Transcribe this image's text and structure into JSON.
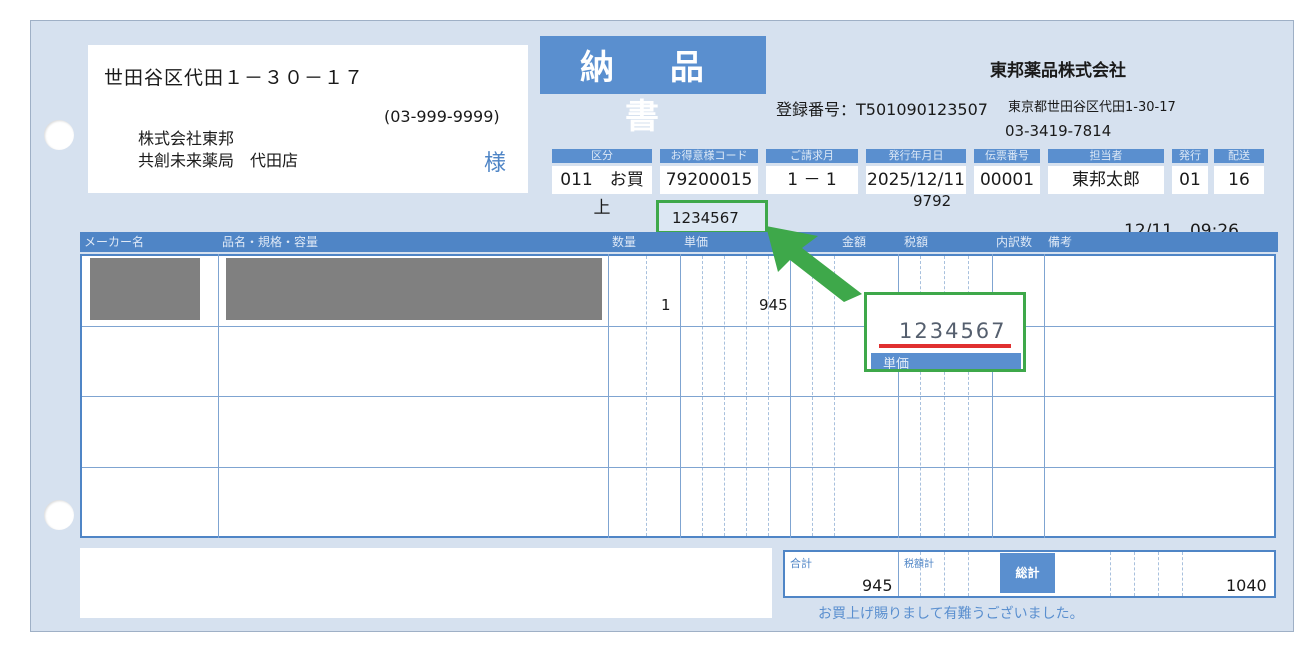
{
  "document": {
    "title": "納 品 書",
    "recipient": {
      "address": "世田谷区代田１－３０－１７",
      "phone": "(03-999-9999)",
      "company": "株式会社東邦",
      "store": "共創未来薬局　代田店",
      "honorific": "様"
    },
    "issuer": {
      "name": "東邦薬品株式会社",
      "registration": "登録番号：T501090123507",
      "address": "東京都世田谷区代田1-30-17",
      "phone": "03-3419-7814"
    },
    "header_labels": [
      "区分",
      "お得意様コード",
      "ご請求月",
      "発行年月日",
      "伝票番号",
      "担当者",
      "発行",
      "配送"
    ],
    "header_values": [
      "011　お買上",
      "79200015",
      "1 － 1",
      "2025/12/11",
      "00001",
      "東邦太郎",
      "01",
      "16"
    ],
    "extra_code": "9792",
    "timestamp": "12/11　09:26",
    "column_headers": [
      "メーカー名",
      "品名・規格・容量",
      "数量",
      "単価",
      "金額",
      "税額",
      "内訳数",
      "備考"
    ],
    "rows": [
      {
        "maker": "",
        "product": "",
        "quantity": "1",
        "amount": "945"
      }
    ],
    "totals": {
      "sum_label": "合計",
      "sum_value": "945",
      "tax_label": "税額計",
      "grand_label": "総計",
      "grand_value": "1040"
    },
    "thanks": "お買上げ賜りまして有難うございました。"
  },
  "annotation": {
    "small_value": "1234567",
    "zoom_value": "1234567",
    "zoom_label": "単価",
    "colors": {
      "highlight": "#3ea84a",
      "underline": "#e03030"
    }
  }
}
